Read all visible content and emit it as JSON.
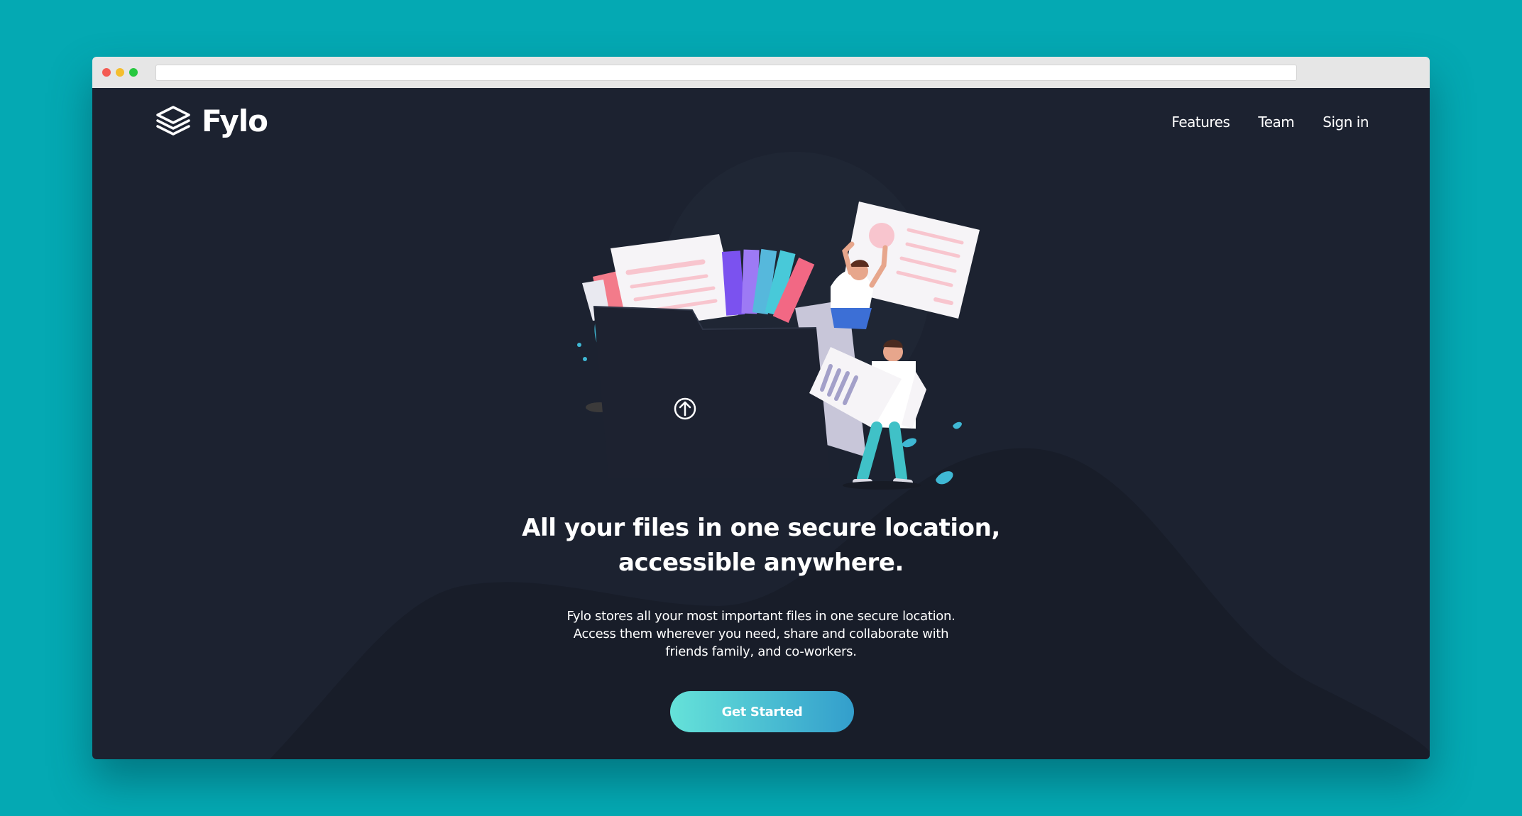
{
  "brand": {
    "name": "Fylo",
    "icon": "stacked-layers-icon"
  },
  "nav": {
    "items": [
      "Features",
      "Team",
      "Sign in"
    ]
  },
  "hero": {
    "headline_lines": [
      "All your files in one secure location,",
      "accessible anywhere."
    ],
    "description_lines": [
      "Fylo stores all your most important files in one secure location.",
      "Access them wherever you need, share and collaborate with",
      "friends family, and co-workers."
    ],
    "cta_label": "Get Started",
    "illustration_icon": "upload-arrow-icon"
  },
  "colors": {
    "outer_background": "#04a9b3",
    "page_background": "#1c2230",
    "hill": "#181d29",
    "cta_gradient_start": "#65e2d9",
    "cta_gradient_end": "#339ecc"
  }
}
